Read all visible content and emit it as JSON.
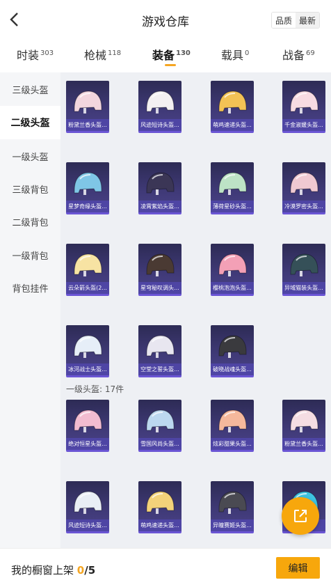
{
  "header": {
    "title": "游戏仓库",
    "sort_options": [
      "品质",
      "最新"
    ],
    "sort_active": 0
  },
  "tabs": [
    {
      "label": "时装",
      "count": "303"
    },
    {
      "label": "枪械",
      "count": "118"
    },
    {
      "label": "装备",
      "count": "130",
      "active": true
    },
    {
      "label": "载具",
      "count": "0"
    },
    {
      "label": "战备",
      "count": "69"
    }
  ],
  "sidebar": {
    "items": [
      "三级头盔",
      "二级头盔",
      "一级头盔",
      "三级背包",
      "二级背包",
      "一级背包",
      "背包挂件"
    ],
    "active_index": 1
  },
  "sections": [
    {
      "title": "",
      "items": [
        {
          "label": "粉黛兰香头盔...",
          "color": "#f2d6de"
        },
        {
          "label": "风迹短诗头盔...",
          "color": "#f4f0f2"
        },
        {
          "label": "萌鸡速递头盔...",
          "color": "#f3c255"
        },
        {
          "label": "千金淑媛头盔...",
          "color": "#f7dbe2"
        },
        {
          "label": "星梦奇缘头盔...",
          "color": "#7fc6e6"
        },
        {
          "label": "凌霄紫焰头盔...",
          "color": "#3b3656"
        },
        {
          "label": "薄荷星砂头盔...",
          "color": "#bde3c6"
        },
        {
          "label": "冷漠罗密头盔...",
          "color": "#f0c9d2"
        },
        {
          "label": "云朵箭头盔(2...",
          "color": "#f7e3a3"
        },
        {
          "label": "星穹秘叹调头...",
          "color": "#4a3a33"
        },
        {
          "label": "樱桃泡泡头盔...",
          "color": "#f3a0b6"
        },
        {
          "label": "异域猫装头盔...",
          "color": "#355058"
        },
        {
          "label": "冰河战士头盔...",
          "color": "#e6eef8"
        },
        {
          "label": "空堂之誓头盔...",
          "color": "#e8e6f0"
        },
        {
          "label": "破晓战魂头盔...",
          "color": "#3a3a3e"
        }
      ]
    },
    {
      "title": "一级头盔: 17件",
      "items": [
        {
          "label": "绝对恒星头盔...",
          "color": "#f2bcd0"
        },
        {
          "label": "雪国风尚头盔...",
          "color": "#bcd8ef"
        },
        {
          "label": "炫彩甜果头盔...",
          "color": "#f5b89c"
        },
        {
          "label": "粉黛兰香头盔...",
          "color": "#f5dde3"
        },
        {
          "label": "风迹短诗头盔...",
          "color": "#e9eef5"
        },
        {
          "label": "萌鸡速递头盔...",
          "color": "#f3d27a"
        },
        {
          "label": "异瞳赛姬头盔...",
          "color": "#4a4a52"
        },
        {
          "label": "",
          "color": "#3ec3e0"
        }
      ]
    }
  ],
  "footer": {
    "label": "我的橱窗上架",
    "current": "0",
    "total": "/5",
    "edit_label": "编辑"
  },
  "colors": {
    "accent": "#f7a70c",
    "card_bg": "#3a356e"
  }
}
